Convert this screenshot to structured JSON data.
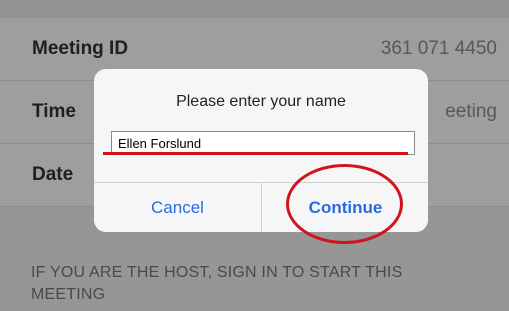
{
  "meeting": {
    "rows": [
      {
        "label": "Meeting ID",
        "value": "361 071 4450"
      },
      {
        "label": "Time",
        "value": "eeting"
      },
      {
        "label": "Date",
        "value": ""
      }
    ],
    "host_note": "IF YOU ARE THE HOST, SIGN IN TO START THIS MEETING"
  },
  "dialog": {
    "title": "Please enter your name",
    "name_value": "Ellen Forslund",
    "cancel_label": "Cancel",
    "continue_label": "Continue"
  },
  "colors": {
    "accent_blue": "#2a6ae0",
    "annotation_red": "#d0141b"
  }
}
